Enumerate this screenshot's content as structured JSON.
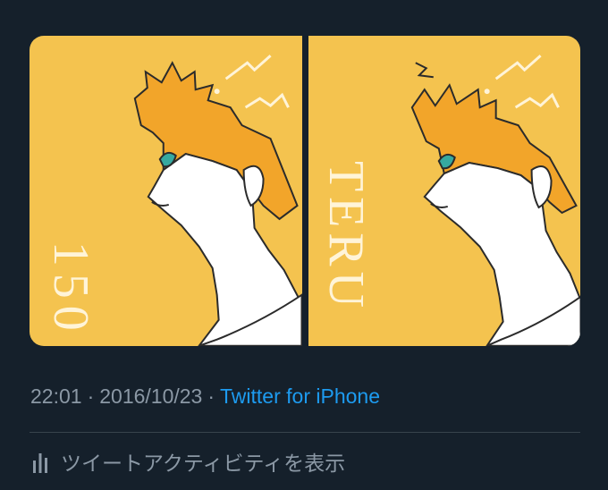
{
  "media": {
    "images": [
      {
        "alt_label": "image-1",
        "caption": "150"
      },
      {
        "alt_label": "image-2",
        "caption": "TERU"
      }
    ],
    "colors": {
      "background": "#f4c34f",
      "caption": "#fff4d8"
    }
  },
  "tweet": {
    "time": "22:01",
    "separator": "·",
    "date": "2016/10/23",
    "source": "Twitter for iPhone"
  },
  "activity": {
    "label": "ツイートアクティビティを表示",
    "icon": "bar-chart-icon"
  },
  "theme": {
    "background": "#15202b",
    "secondary_text": "#8b98a5",
    "link": "#1d9bf0",
    "divider": "#38444d"
  }
}
